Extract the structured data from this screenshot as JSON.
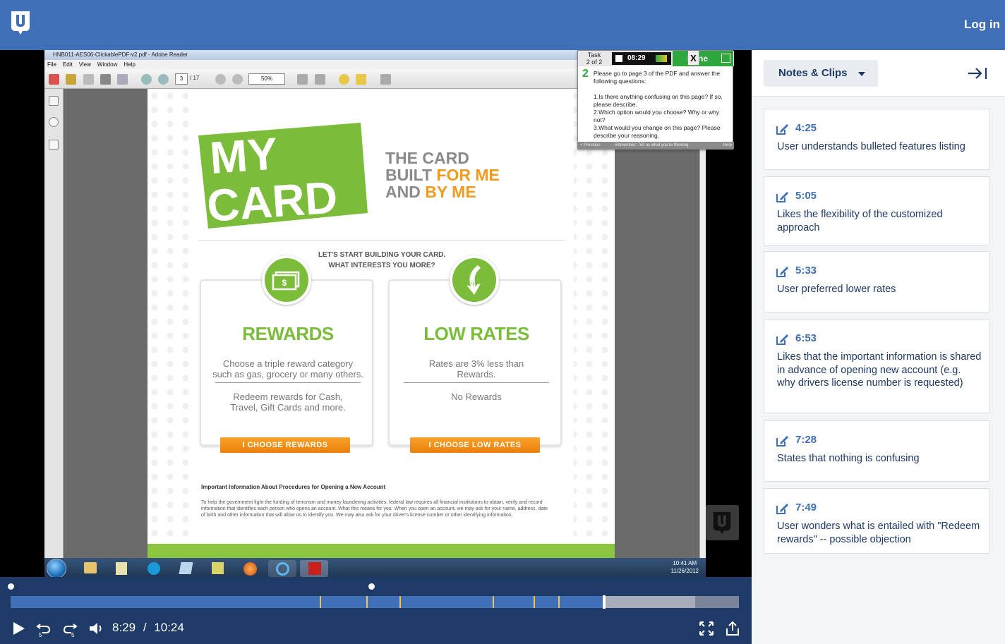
{
  "header": {
    "login_label": "Log in"
  },
  "video": {
    "window_title": "HNB011-AES06-ClickablePDF-v2.pdf - Adobe Reader",
    "menu": [
      "File",
      "Edit",
      "View",
      "Window",
      "Help"
    ],
    "page_current": "3",
    "page_total": "/ 17",
    "zoom": "50%",
    "pdf": {
      "tagline_1": "THE CARD",
      "tagline_2a": "BUILT ",
      "tagline_2b": "FOR ME",
      "tagline_3a": "AND ",
      "tagline_3b": "BY ME",
      "start_line1": "LET'S START BUILDING YOUR CARD.",
      "start_line2": "WHAT INTERESTS YOU MORE?",
      "options": [
        {
          "title": "REWARDS",
          "desc": "Choose a triple reward category such as gas, grocery or many others.",
          "sub": "Redeem rewards for Cash, Travel, Gift Cards and more.",
          "button": "I CHOOSE REWARDS"
        },
        {
          "title": "LOW RATES",
          "desc": "Rates are 3% less than Rewards.",
          "sub": "No Rewards",
          "button": "I CHOOSE LOW RATES"
        }
      ],
      "important_title": "Important Information About Procedures for Opening a New Account",
      "important_body": "To help the government fight the funding of terrorism and money laundering activities, federal law requires all financial institutions to obtain, verify and record information that identifies each person who opens an account. What this means for you: When you open an account, we may ask for your name, address, date of birth and other information that will allow us to identify you. We may also ask for your driver's license number or other identifying information."
    },
    "task": {
      "label_line1": "Task",
      "label_line2": "2 of 2",
      "timer": "08:29",
      "done_label": "Done",
      "close_label": "X",
      "number": "2",
      "text": "Please go to page 3 of the PDF and answer the following questions:\n\n1.Is there anything confusing on this page? If so, please describe.\n2.Which option would you choose? Why or why not?\n3.What would you change on this page? Please describe your reasoning.",
      "prev_label": "< Previous",
      "remember_label": "Remember: Tell us what you're thinking",
      "help_label": "Help"
    },
    "clock_time": "10:41 AM",
    "clock_date": "11/26/2012"
  },
  "player": {
    "current_time": "8:29",
    "separator": "/",
    "duration": "10:24",
    "progress_fraction": 0.815,
    "buffered_fraction": 0.94,
    "marker_times": [
      "4:25",
      "5:05",
      "5:33",
      "6:53",
      "7:28",
      "7:49"
    ]
  },
  "panel": {
    "dropdown_label": "Notes & Clips",
    "notes": [
      {
        "time": "4:25",
        "text": "User understands bulleted features listing"
      },
      {
        "time": "5:05",
        "text": "Likes the flexibility of the customized approach"
      },
      {
        "time": "5:33",
        "text": "User preferred lower rates"
      },
      {
        "time": "6:53",
        "text": "Likes that the important information is shared in advance of opening new account (e.g. why drivers license number is requested)"
      },
      {
        "time": "7:28",
        "text": "States that nothing is confusing"
      },
      {
        "time": "7:49",
        "text": "User wonders what is entailed with \"Redeem rewards\" -- possible objection"
      }
    ]
  },
  "colors": {
    "brand_blue": "#3f6fb7",
    "player_navy": "#1e3a66",
    "marker_yellow": "#f2c14e",
    "card_green": "#7bbd3b",
    "cta_orange": "#f29a1f"
  }
}
